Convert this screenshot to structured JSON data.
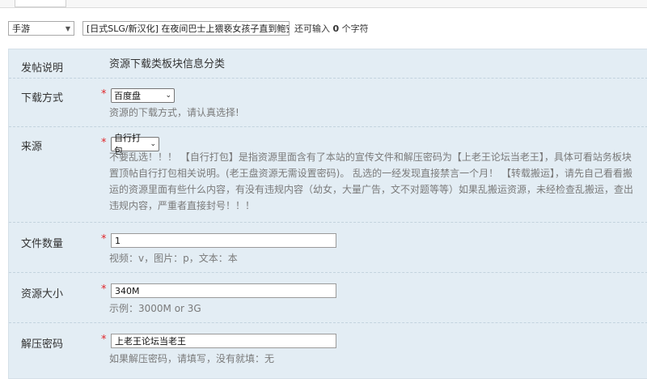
{
  "title_row": {
    "category": "手游",
    "title_value": "[日式SLG/新汉化] 在夜间巴士上猥亵女孩子直到鲍安卓+PC",
    "hint_prefix": "还可输入",
    "hint_count": "0",
    "hint_suffix": "个字符"
  },
  "form": {
    "intro": {
      "label": "发帖说明",
      "text": "资源下载类板块信息分类"
    },
    "download": {
      "label": "下载方式",
      "required": "*",
      "value": "百度盘",
      "help": "资源的下载方式，请认真选择!"
    },
    "source": {
      "label": "来源",
      "required": "*",
      "value": "自行打包",
      "desc": [
        "不要乱选！！！ 【自行打包】是指资源里面含有了本站的宣传文件和解压密码为【上老王论坛当老王】，具体可看站务板块",
        "置顶帖自行打包相关说明。(老王盘资源无需设置密码)。 乱选的一经发现直接禁言一个月！ 【转载搬运】，请先自己看看搬",
        "运的资源里面有些什么内容，有没有违规内容（幼女，大量广告，文不对题等等）如果乱搬运资源，未经检查乱搬运，查出",
        "违规内容，严重者直接封号！！！"
      ]
    },
    "file_count": {
      "label": "文件数量",
      "required": "*",
      "value": "1",
      "help": "视频：v，图片：p，文本：本"
    },
    "size": {
      "label": "资源大小",
      "required": "*",
      "value": "340M",
      "help": "示例：3000M or 3G"
    },
    "password": {
      "label": "解压密码",
      "required": "*",
      "value": "上老王论坛当老王",
      "help": "如果解压密码，请填写，没有就填：无"
    }
  }
}
